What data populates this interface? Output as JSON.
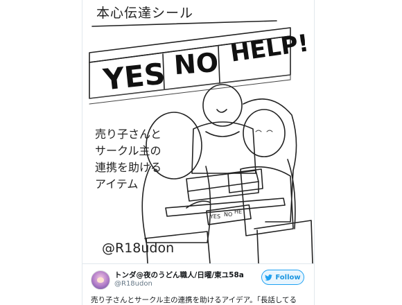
{
  "illustration": {
    "top_caption": "本心伝達シール",
    "side_caption": "売り子さんと\nサークル主の\n連携を助ける\nアイテム",
    "signature": "@R18udon",
    "sign_words": [
      "YES",
      "NO",
      "HELP!"
    ],
    "mini_labels": [
      "YES",
      "NO",
      "HE"
    ]
  },
  "tweet": {
    "display_name": "トンダ@夜のうどん職人/日曜/東ユ58a",
    "handle": "@R18udon",
    "follow_label": "Follow",
    "text": "売り子さんとサークル主の連携を助けるアイデア。「長話してる"
  },
  "colors": {
    "follow_border": "#1da1f2",
    "follow_text": "#1b95e0",
    "name_text": "#14171a",
    "handle_text": "#657786"
  }
}
